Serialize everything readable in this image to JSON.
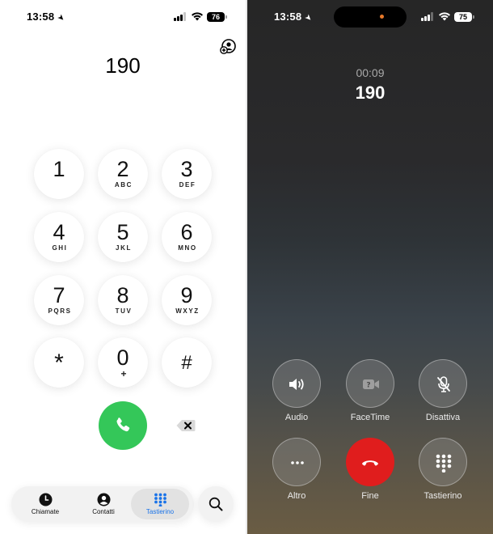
{
  "left": {
    "status": {
      "time": "13:58",
      "battery": "76"
    },
    "dialed_number": "190",
    "keypad": [
      {
        "digit": "1",
        "letters": ""
      },
      {
        "digit": "2",
        "letters": "ABC"
      },
      {
        "digit": "3",
        "letters": "DEF"
      },
      {
        "digit": "4",
        "letters": "GHI"
      },
      {
        "digit": "5",
        "letters": "JKL"
      },
      {
        "digit": "6",
        "letters": "MNO"
      },
      {
        "digit": "7",
        "letters": "PQRS"
      },
      {
        "digit": "8",
        "letters": "TUV"
      },
      {
        "digit": "9",
        "letters": "WXYZ"
      },
      {
        "digit": "*",
        "letters": ""
      },
      {
        "digit": "0",
        "letters": "+"
      },
      {
        "digit": "#",
        "letters": ""
      }
    ],
    "tabs": [
      {
        "label": "Chiamate",
        "icon": "clock-icon"
      },
      {
        "label": "Contatti",
        "icon": "person-icon"
      },
      {
        "label": "Tastierino",
        "icon": "keypad-icon",
        "active": true
      }
    ],
    "accent_color": "#1a73e8",
    "call_color": "#34c759"
  },
  "right": {
    "status": {
      "time": "13:58",
      "battery": "75"
    },
    "timer": "00:09",
    "callee": "190",
    "controls": [
      {
        "label": "Audio",
        "icon": "speaker-icon"
      },
      {
        "label": "FaceTime",
        "icon": "facetime-icon"
      },
      {
        "label": "Disattiva",
        "icon": "mic-off-icon"
      },
      {
        "label": "Altro",
        "icon": "more-icon"
      },
      {
        "label": "Fine",
        "icon": "end-call-icon"
      },
      {
        "label": "Tastierino",
        "icon": "keypad-icon"
      }
    ],
    "end_color": "#e01d1d"
  }
}
